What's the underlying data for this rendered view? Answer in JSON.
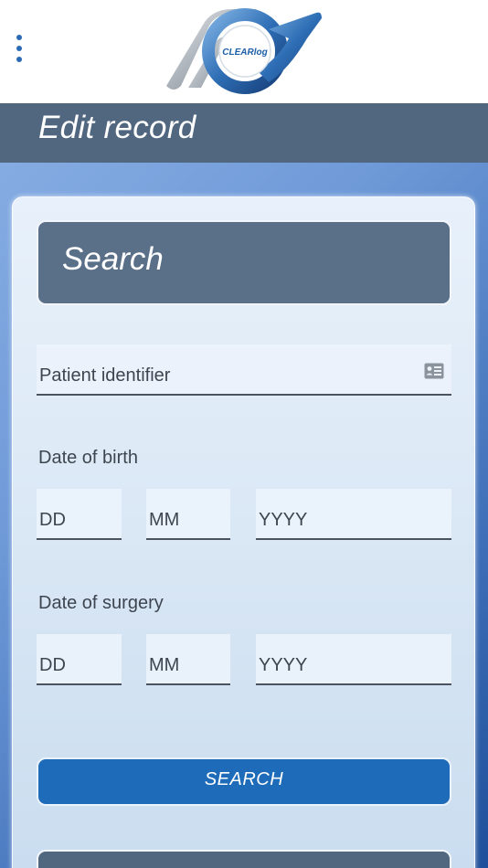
{
  "header": {
    "logo_text": "CLEARlog",
    "menu_icon": "vertical-dots-icon"
  },
  "page": {
    "title": "Edit record"
  },
  "search_panel": {
    "header_label": "Search",
    "patient_identifier": {
      "placeholder": "Patient identifier",
      "icon": "id-card-icon"
    },
    "date_of_birth": {
      "label": "Date of birth",
      "day_placeholder": "DD",
      "month_placeholder": "MM",
      "year_placeholder": "YYYY"
    },
    "date_of_surgery": {
      "label": "Date of surgery",
      "day_placeholder": "DD",
      "month_placeholder": "MM",
      "year_placeholder": "YYYY"
    },
    "search_button_label": "SEARCH"
  },
  "colors": {
    "header_bar": "#51677f",
    "search_header": "#5a6f88",
    "button": "#1e6bb9",
    "accent": "#2b6ab5"
  }
}
